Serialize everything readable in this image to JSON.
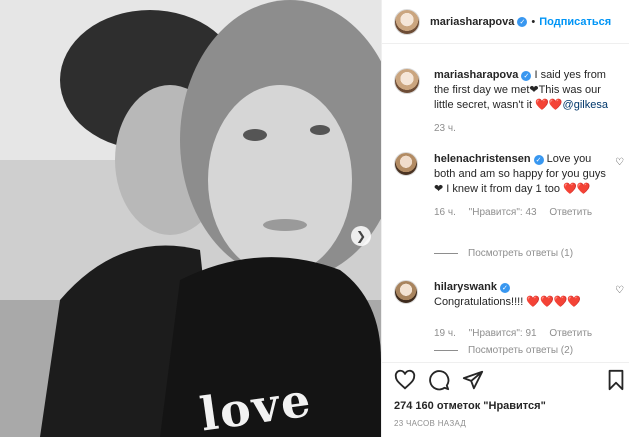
{
  "post": {
    "author": "mariasharapova",
    "follow_label": "Подписаться",
    "dot": "•",
    "photo_text": "love"
  },
  "caption": {
    "author": "mariasharapova",
    "text": "I said yes from the first day we met❤This was our little secret, wasn't it ❤️❤️",
    "mention": "@gilkesa",
    "time": "23 ч."
  },
  "comments": [
    {
      "author": "helenachristensen",
      "text": "Love you both and am so happy for you guys ❤ I knew it from day 1 too ❤️❤️",
      "time": "16 ч.",
      "likes": "\"Нравится\": 43",
      "reply": "Ответить",
      "view_replies": "Посмотреть ответы (1)"
    },
    {
      "author": "hilaryswank",
      "text": "Congratulations!!!! ❤️❤️❤️❤️",
      "time": "19 ч.",
      "likes": "\"Нравится\": 91",
      "reply": "Ответить",
      "view_replies": "Посмотреть ответы (2)"
    }
  ],
  "footer": {
    "likes_text": "274 160 отметок \"Нравится\"",
    "timestamp": "23 ЧАСОВ НАЗАД"
  },
  "icons": {
    "heart": "heart-icon",
    "comment": "comment-icon",
    "share": "share-icon",
    "bookmark": "bookmark-icon",
    "verified": "verified-badge-icon",
    "next": "chevron-right-icon"
  },
  "colors": {
    "link_blue": "#0095f6",
    "verified_blue": "#3897f0",
    "muted": "#8e8e8e",
    "text": "#262626"
  }
}
